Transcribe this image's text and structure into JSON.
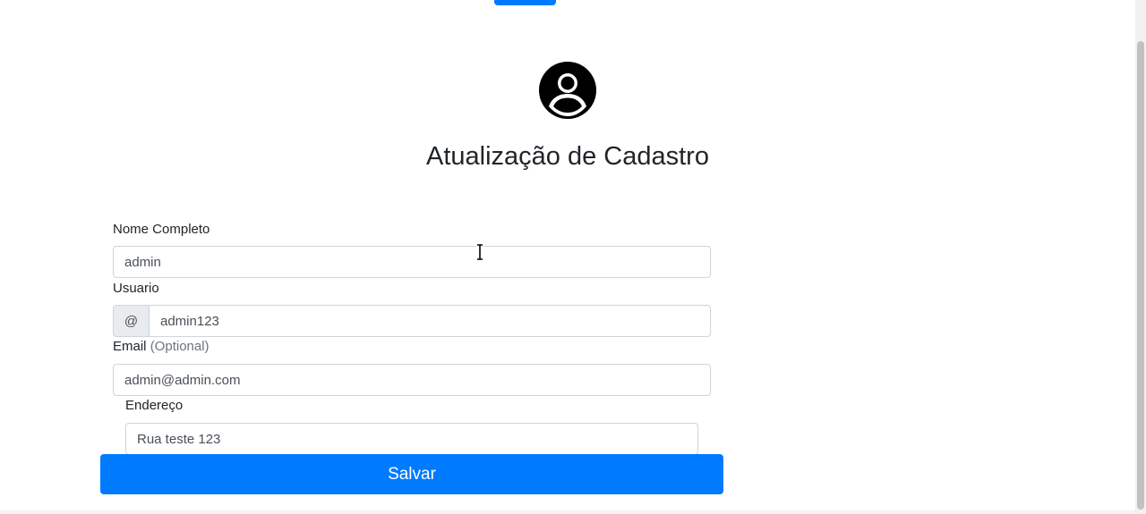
{
  "page": {
    "title": "Atualização de Cadastro"
  },
  "icons": {
    "avatar": "user-circle-icon",
    "cursor": "text-cursor-icon"
  },
  "form": {
    "nome": {
      "label": "Nome Completo",
      "value": "admin"
    },
    "usuario": {
      "label": "Usuario",
      "prefix": "@",
      "value": "admin123"
    },
    "email": {
      "label": "Email",
      "optional": "(Optional)",
      "value": "admin@admin.com"
    },
    "endereco": {
      "label": "Endereço",
      "value": "Rua teste 123"
    },
    "submit_label": "Salvar"
  },
  "colors": {
    "primary": "#007bff",
    "text": "#212529",
    "muted": "#6c757d",
    "border": "#ced4da",
    "addon_bg": "#e9ecef"
  }
}
